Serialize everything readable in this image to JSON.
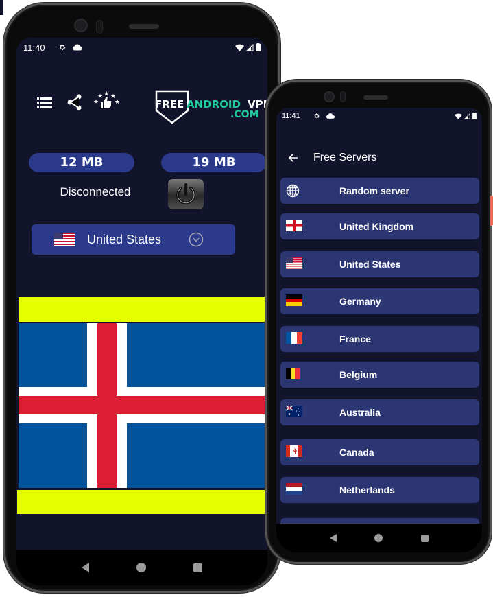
{
  "left_phone": {
    "status_bar": {
      "time": "11:40",
      "icons": [
        "settings-icon",
        "cloud-icon",
        "wifi-icon",
        "signal-icon",
        "battery-icon"
      ]
    },
    "toolbar": {
      "icons": [
        "menu-list-icon",
        "share-icon",
        "rate-stars-thumbs-up-icon"
      ]
    },
    "logo": {
      "free": "FREE",
      "android": "ANDROID",
      "vpn": "VPN",
      "domain": ".COM",
      "accent_color": "#1ec99b"
    },
    "stats": {
      "download": "12 MB",
      "upload": "19 MB"
    },
    "connection_status": "Disconnected",
    "selected_country": {
      "name": "United States",
      "flag": "us"
    },
    "banner": {
      "flag": "iceland",
      "bar_color": "#e6ff00"
    },
    "nav": [
      "back",
      "home",
      "recents"
    ]
  },
  "right_phone": {
    "status_bar": {
      "time": "11:41",
      "icons": [
        "settings-icon",
        "cloud-icon",
        "wifi-icon",
        "signal-icon",
        "battery-icon"
      ]
    },
    "header": {
      "title": "Free Servers"
    },
    "servers": [
      {
        "label": "Random server",
        "flag": "globe"
      },
      {
        "label": "United Kingdom",
        "flag": "england"
      },
      {
        "label": "United States",
        "flag": "us"
      },
      {
        "label": "Germany",
        "flag": "de"
      },
      {
        "label": "France",
        "flag": "fr"
      },
      {
        "label": "Belgium",
        "flag": "be"
      },
      {
        "label": "Australia",
        "flag": "au"
      },
      {
        "label": "Canada",
        "flag": "ca"
      },
      {
        "label": "Netherlands",
        "flag": "nl"
      }
    ],
    "nav": [
      "back",
      "home",
      "recents"
    ]
  },
  "colors": {
    "background": "#11142a",
    "pill": "#2b3a8a",
    "list_item": "#2b3673"
  }
}
